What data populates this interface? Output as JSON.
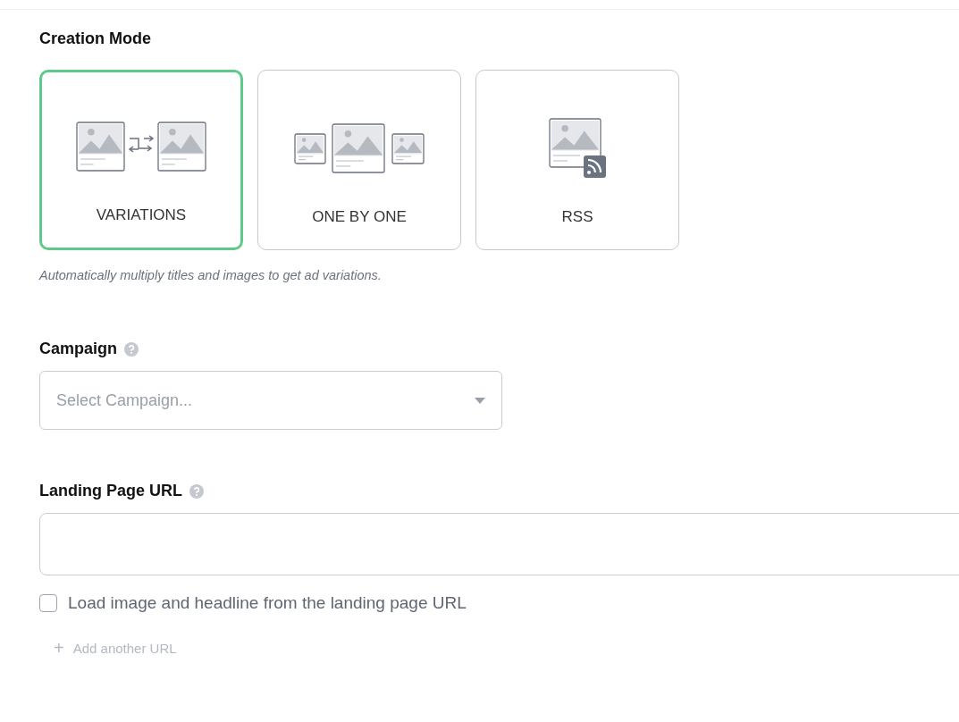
{
  "creation_mode": {
    "title": "Creation Mode",
    "options": [
      {
        "kind": "variations",
        "label": "VARIATIONS",
        "selected": true
      },
      {
        "kind": "one_by_one",
        "label": "ONE BY ONE",
        "selected": false
      },
      {
        "kind": "rss",
        "label": "RSS",
        "selected": false
      }
    ],
    "description": "Automatically multiply titles and images to get ad variations."
  },
  "campaign": {
    "title": "Campaign",
    "placeholder": "Select Campaign..."
  },
  "landing_page": {
    "title": "Landing Page URL",
    "checkbox": {
      "label": "Load image and headline from the landing page URL",
      "checked": false
    },
    "add_link": {
      "icon": "+",
      "label": "Add another URL"
    }
  }
}
